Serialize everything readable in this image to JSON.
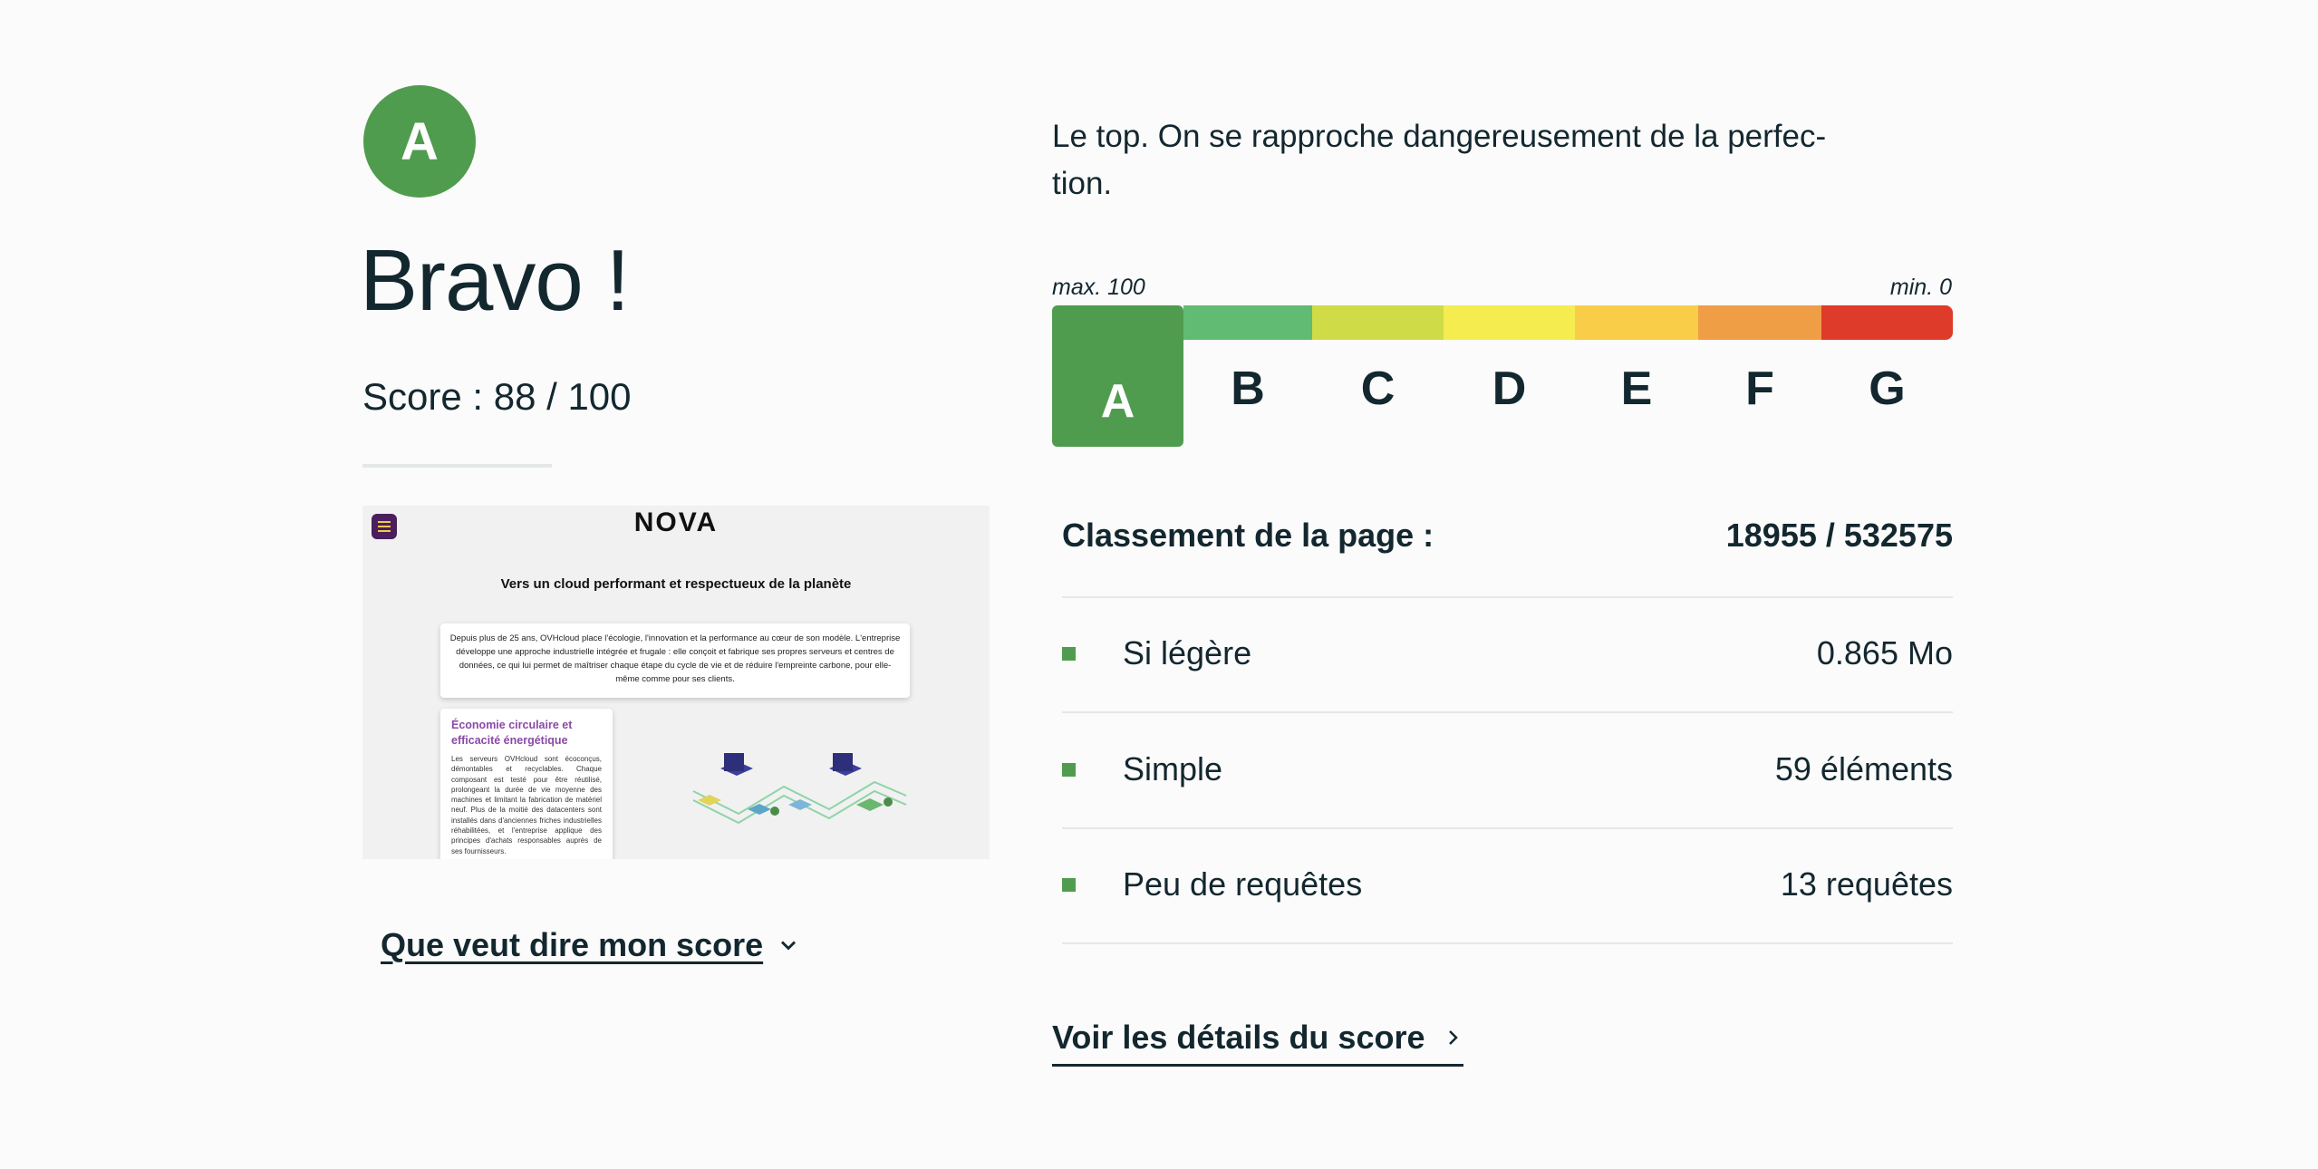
{
  "grade": {
    "letter": "A",
    "color": "#509c4e"
  },
  "headline": "Bravo !",
  "score_text": "Score : 88 / 100",
  "score": 88,
  "score_max": 100,
  "preview": {
    "logo": "NOVA",
    "title": "Vers un cloud performant et respectueux de la planète",
    "intro": "Depuis plus de 25 ans, OVHcloud place l'écologie, l'innovation et la performance au cœur de son modèle. L'entreprise développe une approche industrielle intégrée et frugale : elle conçoit et fabrique ses propres serveurs et centres de données, ce qui lui permet de maîtriser chaque étape du cycle de vie et de réduire l'empreinte carbone, pour elle-même comme pour ses clients.",
    "card_title": "Économie circulaire et efficacité énergétique",
    "card_text": "Les serveurs OVHcloud sont écoconçus, démontables et recyclables. Chaque composant est testé pour être réutilisé, prolongeant la durée de vie moyenne des machines et limitant la fabrication de matériel neuf. Plus de la moitié des datacenters sont installés dans d'anciennes friches industrielles réhabilitées, et l'entreprise applique des principes d'achats responsables auprès de ses fournisseurs."
  },
  "score_link": "Que veut dire mon score",
  "tagline": "Le top. On se rapproche dangereusement de la perfec­tion.",
  "scale": {
    "max_label": "max. 100",
    "min_label": "min. 0",
    "active": "A",
    "grades": [
      {
        "letter": "A",
        "color": "#509c4e"
      },
      {
        "letter": "B",
        "color": "#62bb72"
      },
      {
        "letter": "C",
        "color": "#cfdc47"
      },
      {
        "letter": "D",
        "color": "#f5ec50"
      },
      {
        "letter": "E",
        "color": "#f9cd47"
      },
      {
        "letter": "F",
        "color": "#ef9e46"
      },
      {
        "letter": "G",
        "color": "#df3b2a"
      }
    ]
  },
  "ranking": {
    "label": "Classement de la page :",
    "value": "18955 / 532575"
  },
  "metrics": [
    {
      "label": "Si légère",
      "value": "0.865 Mo"
    },
    {
      "label": "Simple",
      "value": "59 éléments"
    },
    {
      "label": "Peu de requêtes",
      "value": "13 requêtes"
    }
  ],
  "details_link": "Voir les détails du score"
}
